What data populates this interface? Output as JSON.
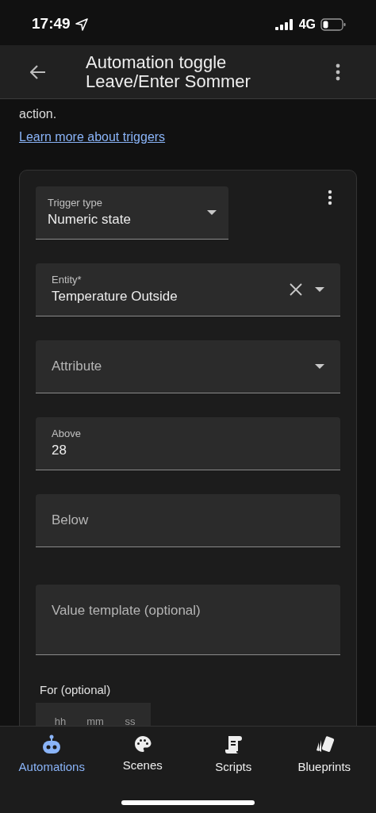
{
  "status_bar": {
    "time": "17:49",
    "network": "4G"
  },
  "header": {
    "title": "Automation toggle Leave/Enter Sommer"
  },
  "intro": {
    "text": "action.",
    "link": "Learn more about triggers"
  },
  "trigger_fields": [
    {
      "kind": "type_select",
      "label": "Trigger type",
      "value": "Numeric state",
      "clearable": false
    },
    {
      "kind": "select",
      "label": "Entity*",
      "value": "Temperature Outside",
      "clearable": true
    },
    {
      "kind": "select",
      "label": "Attribute",
      "clearable": false
    },
    {
      "kind": "text",
      "label": "Above",
      "value": "28",
      "clearable": false
    },
    {
      "kind": "text",
      "label": "Below",
      "clearable": false
    },
    {
      "kind": "textarea",
      "label": "Value template (optional)",
      "clearable": false
    }
  ],
  "duration": {
    "label": "For (optional)",
    "placeholders": [
      "hh",
      "mm",
      "ss"
    ]
  },
  "nav": [
    {
      "kind": "robot",
      "label": "Automations",
      "selected": true
    },
    {
      "kind": "palette",
      "label": "Scenes",
      "selected": false
    },
    {
      "kind": "scroll",
      "label": "Scripts",
      "selected": false
    },
    {
      "kind": "cards",
      "label": "Blueprints",
      "selected": false
    }
  ]
}
